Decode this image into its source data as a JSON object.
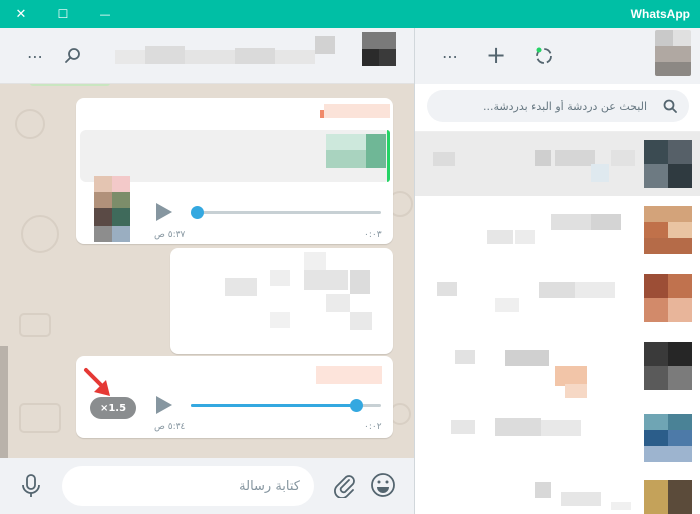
{
  "window": {
    "title": "WhatsApp",
    "close_glyph": "✕",
    "maximize_glyph": "☐",
    "minimize_glyph": "—"
  },
  "chat_header": {
    "menu_glyph": "⋯",
    "search_glyph": "⌕"
  },
  "messages": [
    {
      "type": "voice",
      "time": "٥:٣٧ ص",
      "duration": "٠:٠٣",
      "progress": 0.0
    },
    {
      "type": "voice",
      "time": "٥:٣٤ ص",
      "duration": "٠:٠٢",
      "progress": 0.86,
      "speed_label": "×1.5"
    }
  ],
  "composer": {
    "placeholder": "كتابة رسالة"
  },
  "sidebar": {
    "new_chat_glyph": "+",
    "menu_glyph": "⋯",
    "search_placeholder": "البحث عن دردشة أو البدء بدردشة..."
  },
  "colors": {
    "titlebar": "#00bfa5",
    "accent_blue": "#34a8e0",
    "annotation_arrow": "#e53935"
  }
}
